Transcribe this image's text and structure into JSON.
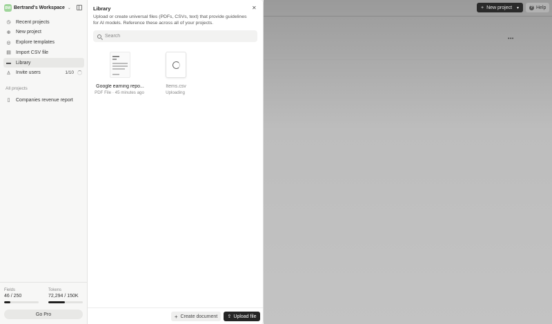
{
  "workspace": {
    "initials": "BW",
    "name": "Bertrand's Workspace"
  },
  "sidebar": {
    "items": [
      {
        "label": "Recent projects",
        "icon": "clock-icon"
      },
      {
        "label": "New project",
        "icon": "plus-circle-icon"
      },
      {
        "label": "Explore templates",
        "icon": "compass-icon"
      },
      {
        "label": "Import CSV file",
        "icon": "table-icon"
      },
      {
        "label": "Library",
        "icon": "folder-icon",
        "active": true
      },
      {
        "label": "Invite users",
        "icon": "user-plus-icon",
        "count": "1/10"
      }
    ],
    "section_label": "All projects",
    "projects": [
      {
        "label": "Companies revenue report",
        "icon": "document-icon"
      }
    ]
  },
  "usage": {
    "fields": {
      "title": "Fields",
      "value": "46 / 250",
      "fraction": 0.184
    },
    "tokens": {
      "title": "Tokens",
      "value": "72,294 / 150K",
      "fraction": 0.482
    },
    "go_pro_label": "Go Pro"
  },
  "topbar": {
    "new_project_label": "New project",
    "help_label": "Help"
  },
  "library": {
    "title": "Library",
    "description": "Upload or create universal files (PDFs, CSVs, text) that provide guidelines for AI models. Reference these across all of your projects.",
    "search_placeholder": "Search",
    "files": [
      {
        "name": "Google earning repo...",
        "meta": "PDF File · 45 minutes ago",
        "type": "pdf"
      },
      {
        "name": "Items.csv",
        "meta": "Uploading",
        "type": "csv"
      }
    ],
    "create_label": "Create document",
    "upload_label": "Upload file"
  },
  "colors": {
    "primary_button": "#252525",
    "overlay": "#b5b5b5",
    "avatar": "#9fd59a"
  }
}
